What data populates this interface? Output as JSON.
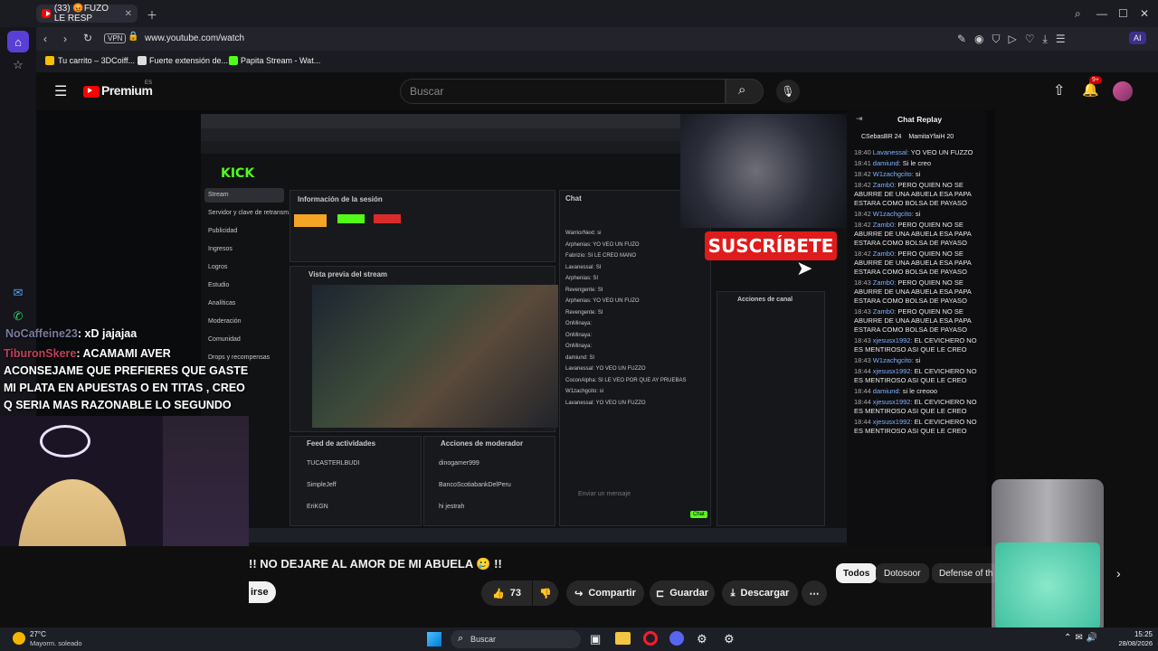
{
  "browser": {
    "active_tab": "(33) 😡FUZO LE RESP",
    "url": "www.youtube.com/watch",
    "vpn": "VPN",
    "bookmarks": [
      "Tu carrito – 3DCoiff...",
      "Fuerte extensión de...",
      "Papita Stream - Wat..."
    ],
    "ai_label": "AI"
  },
  "youtube": {
    "logo": "Premium",
    "logo_region": "ES",
    "search_placeholder": "Buscar",
    "notif_count": "9+",
    "title": "!! NO DEJARE AL AMOR DE MI ABUELA 🥲 !!",
    "subscribe_partial": "irse",
    "likes": "73",
    "share": "Compartir",
    "save": "Guardar",
    "download": "Descargar",
    "chips": [
      "Todos",
      "Dotosoor",
      "Defense of th"
    ]
  },
  "chat_replay": {
    "title": "Chat Replay",
    "top_donors": [
      "CSebasBR 24",
      "MamitaYfaiH 20"
    ],
    "messages": [
      {
        "time": "18:40",
        "user": "Lavanessal:",
        "text": "YO VEO UN FUZZO"
      },
      {
        "time": "18:41",
        "user": "damiund:",
        "text": "Si le creo"
      },
      {
        "time": "18:42",
        "user": "W1zachgcito:",
        "text": "si"
      },
      {
        "time": "18:42",
        "user": "Zamb0:",
        "text": "PERO QUIEN NO SE ABURRE DE UNA ABUELA ESA PAPA ESTARA COMO BOLSA DE PAYASO"
      },
      {
        "time": "18:42",
        "user": "W1zachgcito:",
        "text": "si"
      },
      {
        "time": "18:42",
        "user": "Zamb0:",
        "text": "PERO QUIEN NO SE ABURRE DE UNA ABUELA ESA PAPA ESTARA COMO BOLSA DE PAYASO"
      },
      {
        "time": "18:42",
        "user": "Zamb0:",
        "text": "PERO QUIEN NO SE ABURRE DE UNA ABUELA ESA PAPA ESTARA COMO BOLSA DE PAYASO"
      },
      {
        "time": "18:43",
        "user": "Zamb0:",
        "text": "PERO QUIEN NO SE ABURRE DE UNA ABUELA ESA PAPA ESTARA COMO BOLSA DE PAYASO"
      },
      {
        "time": "18:43",
        "user": "Zamb0:",
        "text": "PERO QUIEN NO SE ABURRE DE UNA ABUELA ESA PAPA ESTARA COMO BOLSA DE PAYASO"
      },
      {
        "time": "18:43",
        "user": "xjesusx1992:",
        "text": "EL CEVICHERO NO ES MENTIROSO ASI QUE LE CREO"
      },
      {
        "time": "18:43",
        "user": "W1zachgcito:",
        "text": "si"
      },
      {
        "time": "18:44",
        "user": "xjesusx1992:",
        "text": "EL CEVICHERO NO ES MENTIROSO ASI QUE LE CREO"
      },
      {
        "time": "18:44",
        "user": "damiund:",
        "text": "si le creooo"
      },
      {
        "time": "18:44",
        "user": "xjesusx1992:",
        "text": "EL CEVICHERO NO ES MENTIROSO ASI QUE LE CREO"
      },
      {
        "time": "18:44",
        "user": "xjesusx1992:",
        "text": "EL CEVICHERO NO ES MENTIROSO ASI QUE LE CREO"
      }
    ]
  },
  "overlay": {
    "subscribe": "SUSCRÍBETE",
    "msg1_user": "NoCaffeine23",
    "msg1_text": ": xD jajajaa",
    "msg2_user": "TiburonSkere",
    "msg2_text": ": ACAMAMI AVER ACONSEJAME QUE PREFIERES QUE GASTE MI PLATA EN APUESTAS O EN TITAS , CREO Q SERIA MAS RAZONABLE LO SEGUNDO"
  },
  "kick": {
    "logo": "KICK",
    "session_title": "Información de la sesión",
    "preview_title": "Vista previa del stream",
    "chat_title": "Chat",
    "activity_title": "Feed de actividades",
    "mod_title": "Acciones de moderador",
    "channel_actions": "Acciones de canal",
    "nav": [
      "Stream",
      "Servidor y clave de retransm.",
      "Publicidad",
      "Ingresos",
      "Logros",
      "Estudio",
      "Analíticas",
      "Moderación",
      "Comunidad",
      "Drops y recompensas"
    ],
    "chat_lines": [
      "WarriorNext: si",
      "Arphenias: YO VEO UN FUZO",
      "Fabrizio: SI LE CREO MANO",
      "Lavanessal: SI",
      "Arphenias: SI",
      "Revengente: SI",
      "Arphenias: YO VEO UN FUZO",
      "Revengente: SI",
      "OnMinaya:",
      "OnMinaya:",
      "OnMinaya:",
      "damiund: SI",
      "Lavanessal: YO VEO UN FUZZO",
      "CoconAlpha: SI LE VEO POR QUE AY PRUEBAS",
      "W1zachgcito: si",
      "Lavanessal: YO VEO UN FUZZO"
    ],
    "chat_input": "Enviar un mensaje",
    "chat_button": "Chat",
    "activity": [
      "TUCASTERLBUDI",
      "SimpleJeff",
      "EriKGN"
    ],
    "mods": [
      "dinogamer999",
      "BancoScotiabankDelPeru",
      "hi jestrah"
    ]
  },
  "taskbar": {
    "weather_temp": "27°C",
    "weather_desc": "Mayorm. soleado",
    "search": "Buscar",
    "time": "15:25",
    "date": "28/08/2026"
  }
}
